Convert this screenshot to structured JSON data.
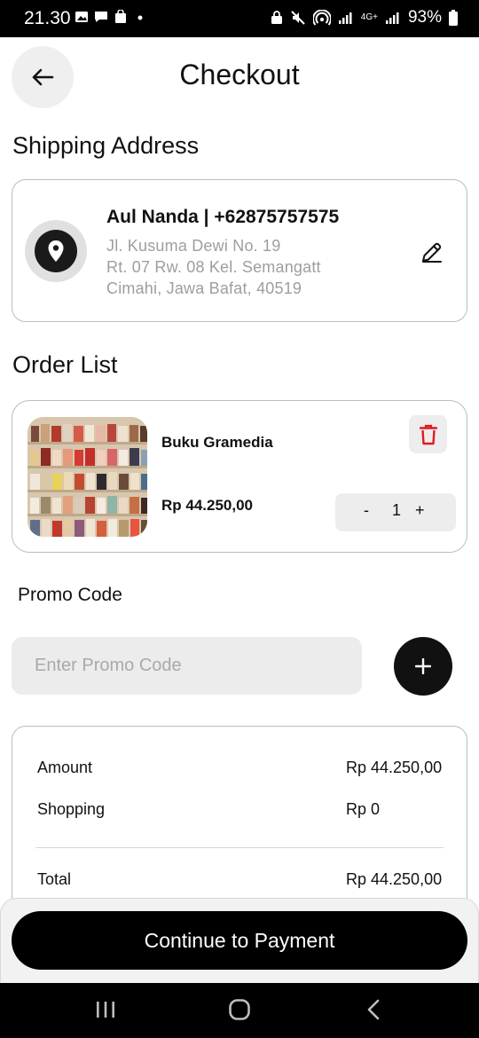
{
  "status_bar": {
    "time": "21.30",
    "battery": "93%",
    "network": "4G+"
  },
  "header": {
    "title": "Checkout",
    "back_icon": "arrow-left-icon"
  },
  "shipping": {
    "section_title": "Shipping Address",
    "name_phone": "Aul Nanda | +62875757575",
    "address_lines": [
      "Jl. Kusuma Dewi No. 19",
      "Rt. 07 Rw. 08 Kel. Semangatt",
      "Cimahi, Jawa Bafat, 40519"
    ],
    "icon": "location-pin-icon",
    "edit_icon": "pencil-icon"
  },
  "order": {
    "section_title": "Order List",
    "items": [
      {
        "name": "Buku Gramedia",
        "price": "Rp 44.250,00",
        "quantity": "1",
        "minus": "-",
        "plus": "+",
        "delete_icon": "trash-icon"
      }
    ]
  },
  "promo": {
    "label": "Promo Code",
    "placeholder": "Enter Promo Code",
    "value": "",
    "add_icon": "plus-icon"
  },
  "summary": {
    "rows": [
      {
        "label": "Amount",
        "value": "Rp 44.250,00"
      },
      {
        "label": "Shopping",
        "value": "Rp 0"
      }
    ],
    "total_label": "Total",
    "total_value": "Rp 44.250,00"
  },
  "footer": {
    "pay_label": "Continue to Payment"
  },
  "colors": {
    "accent": "#000000",
    "danger": "#e01b24",
    "muted_text": "#9e9e9e",
    "surface": "#ececec"
  }
}
